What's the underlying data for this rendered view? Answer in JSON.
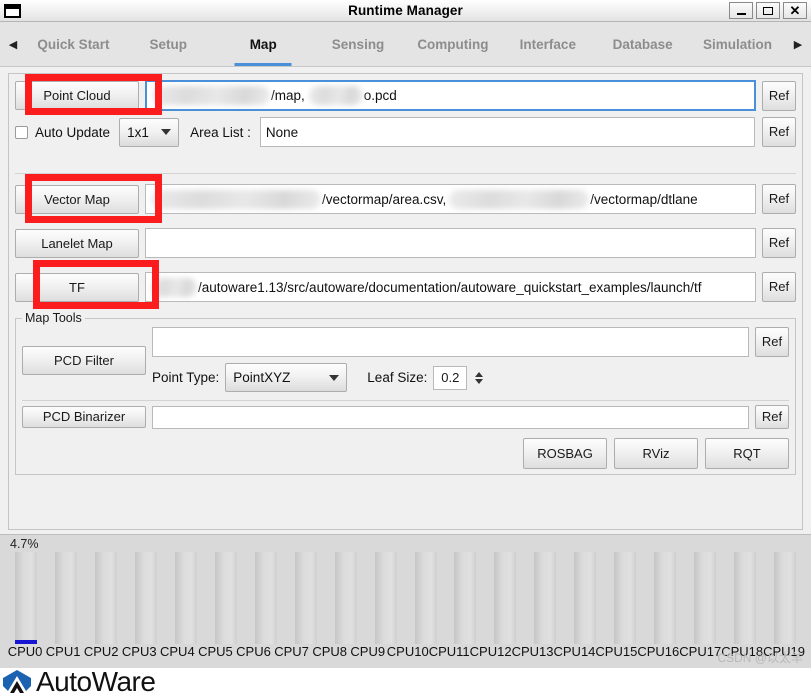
{
  "window": {
    "title": "Runtime Manager",
    "icon": "window-icon",
    "buttons": {
      "minimize": "minimize-icon",
      "maximize": "maximize-icon",
      "close": "close-icon"
    }
  },
  "tabbar": {
    "prev_arrow": "◀",
    "next_arrow": "▶",
    "active": "Map",
    "tabs": [
      {
        "label": "Quick Start"
      },
      {
        "label": "Setup"
      },
      {
        "label": "Map"
      },
      {
        "label": "Sensing"
      },
      {
        "label": "Computing"
      },
      {
        "label": "Interface"
      },
      {
        "label": "Database"
      },
      {
        "label": "Simulation"
      }
    ]
  },
  "map_panel": {
    "point_cloud": {
      "button_label": "Point Cloud",
      "path_text_mid": "/map,",
      "path_text_end": "o.pcd",
      "ref_label": "Ref",
      "highlighted": true
    },
    "auto_update": {
      "checkbox_label": "Auto Update",
      "checked": false,
      "grid_value": "1x1",
      "area_list_label": "Area List :",
      "area_list_value": "None",
      "ref_label": "Ref"
    },
    "vector_map": {
      "button_label": "Vector Map",
      "path_text_mid": "/vectormap/area.csv,",
      "path_text_end": "/vectormap/dtlane",
      "ref_label": "Ref",
      "highlighted": true
    },
    "lanelet_map": {
      "button_label": "Lanelet Map",
      "path_value": "",
      "ref_label": "Ref"
    },
    "tf": {
      "button_label": "TF",
      "path_text": "/autoware1.13/src/autoware/documentation/autoware_quickstart_examples/launch/tf",
      "ref_label": "Ref",
      "highlighted": true
    }
  },
  "map_tools": {
    "group_title": "Map Tools",
    "pcd_filter": {
      "button_label": "PCD Filter",
      "path_value": "",
      "ref_label": "Ref",
      "point_type_label": "Point Type:",
      "point_type_value": "PointXYZ",
      "leaf_size_label": "Leaf Size:",
      "leaf_size_value": "0.2"
    },
    "pcd_binarizer": {
      "button_label": "PCD Binarizer",
      "path_value": "",
      "ref_label": "Ref"
    },
    "actions": [
      {
        "label": "ROSBAG"
      },
      {
        "label": "RViz"
      },
      {
        "label": "RQT"
      }
    ]
  },
  "cpu_monitor": {
    "percent_label": "4.7%",
    "cores": [
      {
        "label": "CPU0",
        "value": 4.7
      },
      {
        "label": "CPU1",
        "value": 0
      },
      {
        "label": "CPU2",
        "value": 0
      },
      {
        "label": "CPU3",
        "value": 0
      },
      {
        "label": "CPU4",
        "value": 0
      },
      {
        "label": "CPU5",
        "value": 0
      },
      {
        "label": "CPU6",
        "value": 0
      },
      {
        "label": "CPU7",
        "value": 0
      },
      {
        "label": "CPU8",
        "value": 0
      },
      {
        "label": "CPU9",
        "value": 0
      },
      {
        "label": "CPU10",
        "value": 0
      },
      {
        "label": "CPU11",
        "value": 0
      },
      {
        "label": "CPU12",
        "value": 0
      },
      {
        "label": "CPU13",
        "value": 0
      },
      {
        "label": "CPU14",
        "value": 0
      },
      {
        "label": "CPU15",
        "value": 0
      },
      {
        "label": "CPU16",
        "value": 0
      },
      {
        "label": "CPU17",
        "value": 0
      },
      {
        "label": "CPU18",
        "value": 0
      },
      {
        "label": "CPU19",
        "value": 0
      }
    ],
    "fill_color": "#1515d2"
  },
  "watermark": {
    "text": "CSDN @以太羊"
  },
  "footer": {
    "logo_text": "AutoWare",
    "logo_color": "#1b63b0"
  },
  "colors": {
    "accent": "#4a90d9",
    "annotation": "#fb1d1d",
    "panel_bg": "#f0f0f0",
    "cpu_bg": "#d9d9d9"
  }
}
